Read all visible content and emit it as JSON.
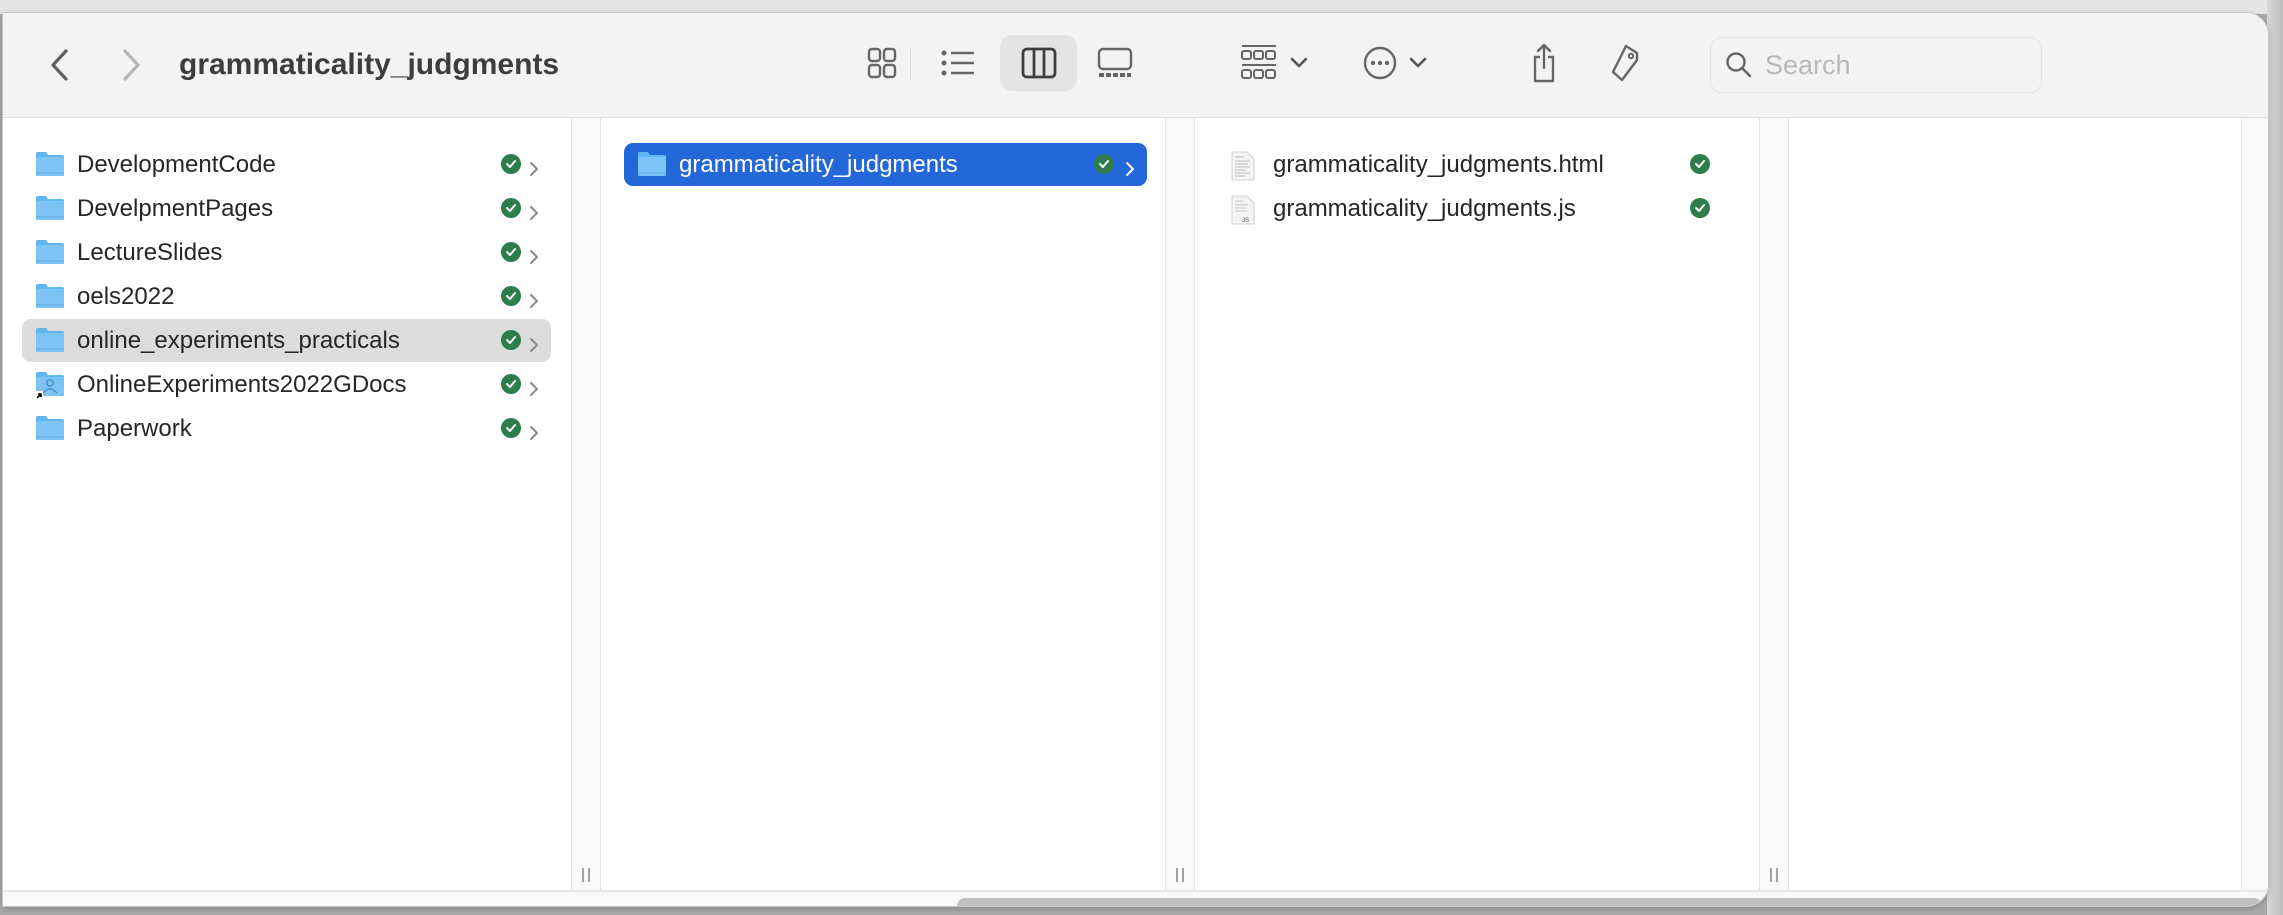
{
  "window": {
    "title": "grammaticality_judgments"
  },
  "toolbar": {
    "back_icon": "chevron-left-icon",
    "forward_icon": "chevron-right-icon",
    "view_modes": [
      {
        "name": "icon-view",
        "icon": "grid-icon",
        "active": false
      },
      {
        "name": "list-view",
        "icon": "list-icon",
        "active": false
      },
      {
        "name": "column-view",
        "icon": "columns-icon",
        "active": true
      },
      {
        "name": "gallery-view",
        "icon": "gallery-icon",
        "active": false
      }
    ],
    "group_icon": "group-by-icon",
    "action_icon": "ellipsis-circle-icon",
    "share_icon": "share-icon",
    "tag_icon": "tag-icon",
    "search": {
      "placeholder": "Search",
      "value": ""
    }
  },
  "columns": [
    {
      "items": [
        {
          "name": "DevelopmentCode",
          "type": "folder",
          "synced": true,
          "selected": false
        },
        {
          "name": "DevelpmentPages",
          "type": "folder",
          "synced": true,
          "selected": false
        },
        {
          "name": "LectureSlides",
          "type": "folder",
          "synced": true,
          "selected": false
        },
        {
          "name": "oels2022",
          "type": "folder",
          "synced": true,
          "selected": false
        },
        {
          "name": "online_experiments_practicals",
          "type": "folder",
          "synced": true,
          "selected": "inactive"
        },
        {
          "name": "OnlineExperiments2022GDocs",
          "type": "shared-folder-alias",
          "synced": true,
          "selected": false
        },
        {
          "name": "Paperwork",
          "type": "folder",
          "synced": true,
          "selected": false
        }
      ]
    },
    {
      "items": [
        {
          "name": "grammaticality_judgments",
          "type": "folder",
          "synced": true,
          "selected": "active"
        }
      ]
    },
    {
      "items": [
        {
          "name": "grammaticality_judgments.html",
          "type": "html-file",
          "synced": true
        },
        {
          "name": "grammaticality_judgments.js",
          "type": "js-file",
          "synced": true
        }
      ]
    },
    {
      "items": []
    }
  ],
  "colors": {
    "selection_active": "#2367d8",
    "selection_inactive": "#dcdcdc",
    "sync_badge": "#2e7d4b",
    "folder": "#5eb5f0"
  }
}
